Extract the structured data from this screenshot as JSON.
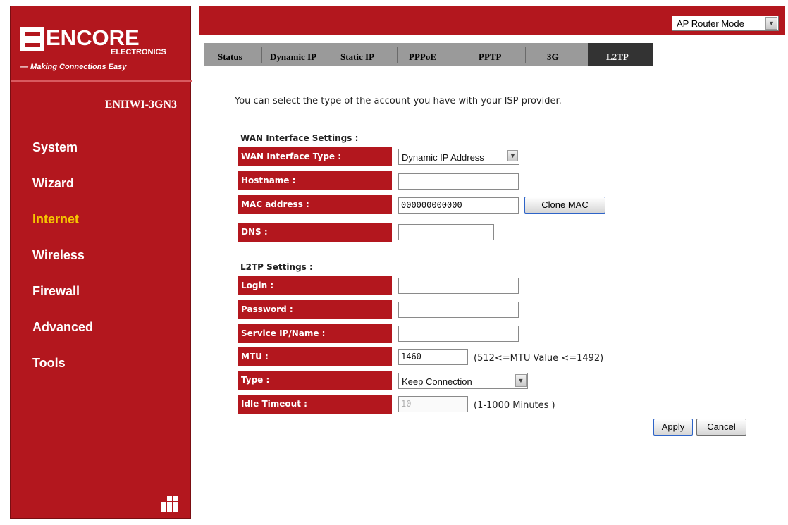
{
  "brand": {
    "name": "ENCORE",
    "sub": "ELECTRONICS",
    "tagline": "— Making Connections Easy",
    "model": "ENHWI-3GN3"
  },
  "sidebar": {
    "items": [
      {
        "label": "System",
        "active": false
      },
      {
        "label": "Wizard",
        "active": false
      },
      {
        "label": "Internet",
        "active": true
      },
      {
        "label": "Wireless",
        "active": false
      },
      {
        "label": "Firewall",
        "active": false
      },
      {
        "label": "Advanced",
        "active": false
      },
      {
        "label": "Tools",
        "active": false
      }
    ]
  },
  "header": {
    "mode_select": "AP Router Mode"
  },
  "tabs": [
    {
      "label": "Status",
      "active": false
    },
    {
      "label": "Dynamic IP",
      "active": false
    },
    {
      "label": "Static IP",
      "active": false
    },
    {
      "label": "PPPoE",
      "active": false
    },
    {
      "label": "PPTP",
      "active": false
    },
    {
      "label": "3G",
      "active": false
    },
    {
      "label": "L2TP",
      "active": true
    }
  ],
  "main": {
    "intro": "You can select the type of the account you have with your ISP provider.",
    "wan": {
      "title": "WAN Interface Settings :",
      "type_label": "WAN Interface Type :",
      "type_value": "Dynamic IP Address",
      "hostname_label": "Hostname :",
      "hostname_value": "",
      "mac_label": "MAC address :",
      "mac_value": "000000000000",
      "clone_mac_button": "Clone MAC",
      "dns_label": "DNS :",
      "dns_value": ""
    },
    "l2tp": {
      "title": "L2TP Settings :",
      "login_label": "Login :",
      "login_value": "",
      "password_label": "Password :",
      "password_value": "",
      "service_label": "Service IP/Name :",
      "service_value": "",
      "mtu_label": "MTU :",
      "mtu_value": "1460",
      "mtu_note": "(512<=MTU Value <=1492)",
      "type_label": "Type :",
      "type_value": "Keep Connection",
      "idle_label": "Idle Timeout :",
      "idle_value": "10",
      "idle_note": "(1-1000 Minutes )"
    },
    "apply_button": "Apply",
    "cancel_button": "Cancel"
  },
  "colors": {
    "brand_red": "#b3171e",
    "active_nav": "#f6c600",
    "tab_bar": "#9a9a9a",
    "active_tab": "#333333"
  }
}
